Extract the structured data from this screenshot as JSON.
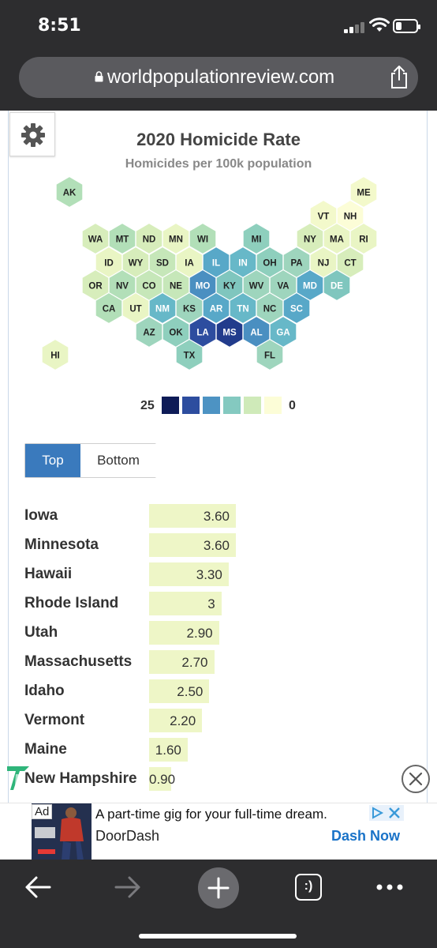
{
  "status_bar": {
    "time": "8:51",
    "battery_level": 0.3
  },
  "browser": {
    "url": "worldpopulationreview.com"
  },
  "chart": {
    "title": "2020 Homicide Rate",
    "subtitle": "Homicides per 100k population",
    "legend": {
      "max_label": "25",
      "min_label": "0",
      "colors": [
        "#0e1b57",
        "#2d4d9f",
        "#4d93c3",
        "#84c9c0",
        "#cfeab9",
        "#fcfdd7"
      ]
    }
  },
  "chart_data": {
    "type": "hexmap",
    "title": "2020 Homicide Rate",
    "subtitle": "Homicides per 100k population",
    "legend_range": [
      25,
      0
    ],
    "states": [
      {
        "code": "AK",
        "color": "#b2dfb8"
      },
      {
        "code": "ME",
        "color": "#f3f9cb"
      },
      {
        "code": "VT",
        "color": "#f3f9cb"
      },
      {
        "code": "NH",
        "color": "#fcfdd7"
      },
      {
        "code": "WA",
        "color": "#d7edbb"
      },
      {
        "code": "MT",
        "color": "#b2dfb8"
      },
      {
        "code": "ND",
        "color": "#d7edbb"
      },
      {
        "code": "MN",
        "color": "#e9f5c4"
      },
      {
        "code": "WI",
        "color": "#b2dfb8"
      },
      {
        "code": "MI",
        "color": "#8ecfbd"
      },
      {
        "code": "NY",
        "color": "#d7edbb"
      },
      {
        "code": "MA",
        "color": "#e9f5c4"
      },
      {
        "code": "RI",
        "color": "#e9f5c4"
      },
      {
        "code": "ID",
        "color": "#e9f5c4"
      },
      {
        "code": "WY",
        "color": "#d7edbb"
      },
      {
        "code": "SD",
        "color": "#c6e7b9"
      },
      {
        "code": "IA",
        "color": "#e9f5c4"
      },
      {
        "code": "IL",
        "color": "#58a8c8"
      },
      {
        "code": "IN",
        "color": "#67b8c8"
      },
      {
        "code": "OH",
        "color": "#8ecfbd"
      },
      {
        "code": "PA",
        "color": "#9ed5bd"
      },
      {
        "code": "NJ",
        "color": "#e9f5c4"
      },
      {
        "code": "CT",
        "color": "#d7edbb"
      },
      {
        "code": "OR",
        "color": "#d7edbb"
      },
      {
        "code": "NV",
        "color": "#b2dfb8"
      },
      {
        "code": "CO",
        "color": "#c6e7b9"
      },
      {
        "code": "NE",
        "color": "#c6e7b9"
      },
      {
        "code": "MO",
        "color": "#4a8fc1"
      },
      {
        "code": "KY",
        "color": "#7fc6be"
      },
      {
        "code": "WV",
        "color": "#9ed5bd"
      },
      {
        "code": "VA",
        "color": "#9ed5bd"
      },
      {
        "code": "MD",
        "color": "#58a8c8"
      },
      {
        "code": "DE",
        "color": "#7fc6be"
      },
      {
        "code": "CA",
        "color": "#b2dfb8"
      },
      {
        "code": "UT",
        "color": "#e9f5c4"
      },
      {
        "code": "NM",
        "color": "#67b8c8"
      },
      {
        "code": "KS",
        "color": "#9ed5bd"
      },
      {
        "code": "AR",
        "color": "#58a8c8"
      },
      {
        "code": "TN",
        "color": "#67b8c8"
      },
      {
        "code": "NC",
        "color": "#9ed5bd"
      },
      {
        "code": "SC",
        "color": "#58a8c8"
      },
      {
        "code": "AZ",
        "color": "#9ed5bd"
      },
      {
        "code": "OK",
        "color": "#8ecfbd"
      },
      {
        "code": "LA",
        "color": "#2d4d9f"
      },
      {
        "code": "MS",
        "color": "#223c8c"
      },
      {
        "code": "AL",
        "color": "#4a8fc1"
      },
      {
        "code": "GA",
        "color": "#67b8c8"
      },
      {
        "code": "HI",
        "color": "#e9f5c4"
      },
      {
        "code": "TX",
        "color": "#8ecfbd"
      },
      {
        "code": "FL",
        "color": "#9ed5bd"
      }
    ],
    "ranking": {
      "type": "bar",
      "categories": [
        "Iowa",
        "Minnesota",
        "Hawaii",
        "Rhode Island",
        "Utah",
        "Massachusetts",
        "Idaho",
        "Vermont",
        "Maine",
        "New Hampshire"
      ],
      "values": [
        3.6,
        3.6,
        3.3,
        3,
        2.9,
        2.7,
        2.5,
        2.2,
        1.6,
        0.9
      ],
      "value_labels": [
        "3.60",
        "3.60",
        "3.30",
        "3",
        "2.90",
        "2.70",
        "2.50",
        "2.20",
        "1.60",
        "0.90"
      ]
    }
  },
  "toggle": {
    "top_label": "Top",
    "bottom_label": "Bottom",
    "selected": "Top"
  },
  "ad": {
    "label": "Ad",
    "headline": "A part-time gig for your full-time dream.",
    "advertiser": "DoorDash",
    "cta": "Dash Now"
  },
  "toolbar": {
    "tabs_label": ":)"
  }
}
